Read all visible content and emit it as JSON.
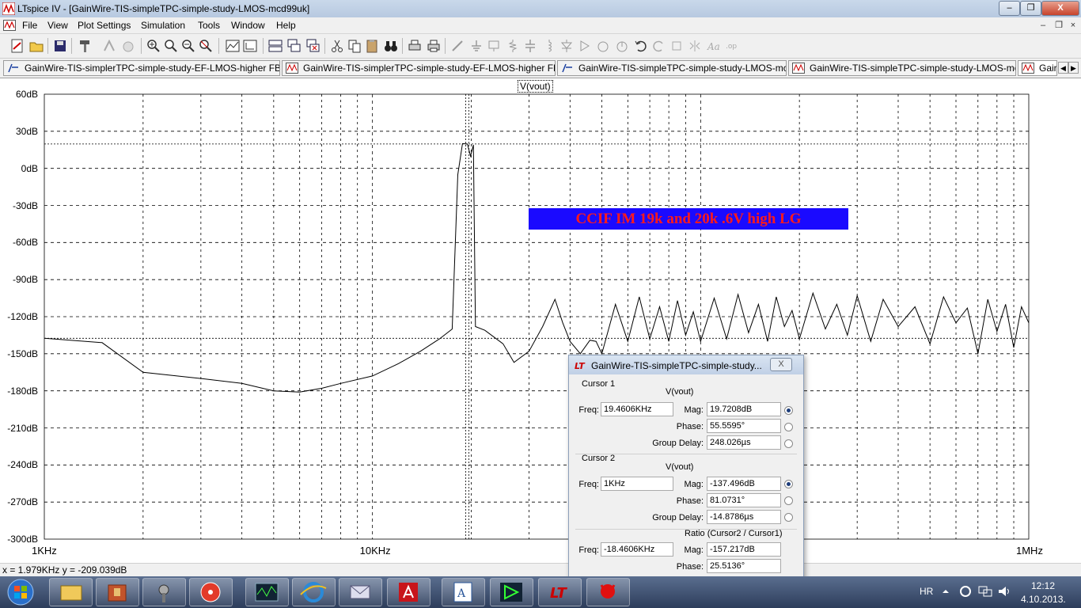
{
  "window": {
    "title": "LTspice IV - [GainWire-TIS-simpleTPC-simple-study-LMOS-mcd99uk]",
    "minimize": "–",
    "maximize": "❐",
    "close": "X"
  },
  "menu": [
    "File",
    "View",
    "Plot Settings",
    "Simulation",
    "Tools",
    "Window",
    "Help"
  ],
  "mdi_controls": [
    "–",
    "❐",
    "×"
  ],
  "tabs": [
    {
      "label": "GainWire-TIS-simplerTPC-simple-study-EF-LMOS-higher FBresistors",
      "icon": "schematic-icon"
    },
    {
      "label": "GainWire-TIS-simplerTPC-simple-study-EF-LMOS-higher FBresistors",
      "icon": "waveform-icon"
    },
    {
      "label": "GainWire-TIS-simpleTPC-simple-study-LMOS-mcd99uk",
      "icon": "schematic-icon"
    },
    {
      "label": "GainWire-TIS-simpleTPC-simple-study-LMOS-mcd99uk",
      "icon": "waveform-icon"
    },
    {
      "label": "Gair",
      "icon": "waveform-icon"
    }
  ],
  "tab_arrows": [
    "◀",
    "▶"
  ],
  "plot": {
    "trace_label": "V(vout)",
    "annotation": "CCIF IM 19k and 20k .6V high LG",
    "annotation_bg": "#1a0aff",
    "annotation_fg": "#ff1a1a"
  },
  "chart_data": {
    "type": "line",
    "title": "V(vout)",
    "xlabel": "",
    "ylabel": "",
    "x_scale": "log",
    "x_ticks": [
      "1KHz",
      "10KHz",
      "1MHz"
    ],
    "y_ticks": [
      "60dB",
      "30dB",
      "0dB",
      "-30dB",
      "-60dB",
      "-90dB",
      "-120dB",
      "-150dB",
      "-180dB",
      "-210dB",
      "-240dB",
      "-270dB",
      "-300dB"
    ],
    "xlim": [
      1000,
      1000000
    ],
    "ylim": [
      -300,
      60
    ],
    "grid": true,
    "cursors": {
      "cursor1_freq": 19460.6,
      "cursor1_mag": 19.7208,
      "cursor2_freq": 1000,
      "cursor2_mag": -137.496
    },
    "series": [
      {
        "x": [
          1000,
          1500,
          2000,
          3000,
          4000,
          5000,
          6000,
          7000,
          8000,
          10000,
          12000,
          14000,
          16000,
          17500,
          18200,
          18800,
          19460.6,
          19900,
          20300,
          20600,
          22000,
          25000,
          27000,
          30000,
          33000,
          36000,
          38000,
          40000,
          43000,
          46000,
          48000,
          50000,
          55000,
          60000,
          65000,
          70000,
          75000,
          80000,
          85000,
          90000,
          95000,
          100000,
          110000,
          120000,
          130000,
          140000,
          150000,
          160000,
          170000,
          180000,
          190000,
          200000,
          220000,
          240000,
          260000,
          280000,
          300000,
          330000,
          360000,
          400000,
          450000,
          500000,
          550000,
          600000,
          650000,
          700000,
          750000,
          800000,
          850000,
          900000,
          950000,
          1000000
        ],
        "y": [
          -137.5,
          -141,
          -165,
          -170,
          -174,
          -180,
          -181,
          -178,
          -174,
          -168,
          -158,
          -148,
          -138,
          -130,
          -5,
          20,
          19.7,
          10,
          19,
          -128,
          -131,
          -142,
          -157,
          -148,
          -128,
          -106,
          -125,
          -140,
          -150,
          -139,
          -140,
          -150,
          -110,
          -140,
          -104,
          -138,
          -112,
          -140,
          -107,
          -135,
          -116,
          -140,
          -105,
          -138,
          -102,
          -133,
          -110,
          -140,
          -104,
          -128,
          -115,
          -138,
          -101,
          -130,
          -110,
          -135,
          -103,
          -140,
          -106,
          -128,
          -112,
          -142,
          -104,
          -125,
          -113,
          -150,
          -106,
          -132,
          -110,
          -145,
          -112,
          -125
        ]
      }
    ]
  },
  "status_bar": {
    "coords": "x = 1.979KHz   y = -209.039dB"
  },
  "cursor_dialog": {
    "title": "GainWire-TIS-simpleTPC-simple-study...",
    "close": "X",
    "cursor1": {
      "group": "Cursor 1",
      "trace": "V(vout)",
      "freq_label": "Freq:",
      "freq": "19.4606KHz",
      "mag_label": "Mag:",
      "mag": "19.7208dB",
      "phase_label": "Phase:",
      "phase": "55.5595°",
      "gd_label": "Group Delay:",
      "gd": "248.026µs"
    },
    "cursor2": {
      "group": "Cursor 2",
      "trace": "V(vout)",
      "freq_label": "Freq:",
      "freq": "1KHz",
      "mag_label": "Mag:",
      "mag": "-137.496dB",
      "phase_label": "Phase:",
      "phase": "81.0731°",
      "gd_label": "Group Delay:",
      "gd": "-14.8786µs"
    },
    "ratio": {
      "group": "Ratio (Cursor2 / Cursor1)",
      "freq_label": "Freq:",
      "freq": "-18.4606KHz",
      "mag_label": "Mag:",
      "mag": "-157.217dB",
      "phase_label": "Phase:",
      "phase": "25.5136°"
    }
  },
  "taskbar": {
    "lang": "HR",
    "time": "12:12",
    "date": "4.10.2013.",
    "buttons": [
      "explorer",
      "archive",
      "tool",
      "burner",
      "scope",
      "ie",
      "mail",
      "pdf",
      "word",
      "ltspice-e",
      "ltspice",
      "devil"
    ]
  }
}
